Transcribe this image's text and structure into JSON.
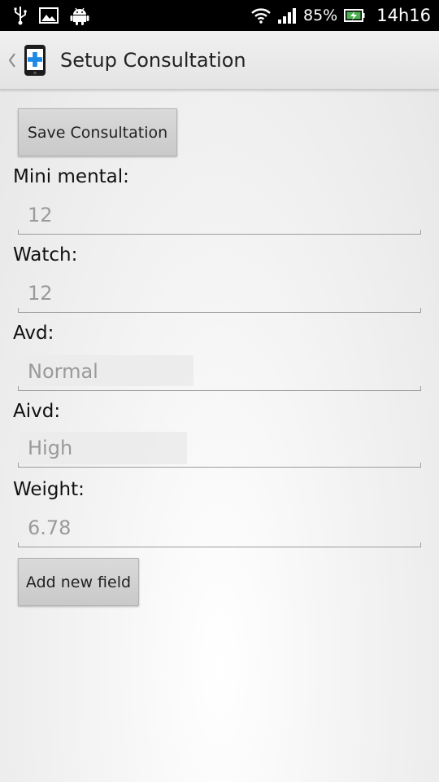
{
  "status_bar": {
    "battery_percent": "85%",
    "time": "14h16",
    "icons": [
      "usb-icon",
      "image-icon",
      "android-icon",
      "wifi-icon",
      "signal-icon",
      "battery-icon"
    ]
  },
  "action_bar": {
    "title": "Setup Consultation",
    "icons": [
      "back-caret-icon",
      "app-medical-phone-icon"
    ]
  },
  "form": {
    "save_button": "Save Consultation",
    "fields": [
      {
        "label": "Mini mental:",
        "value": "12"
      },
      {
        "label": "Watch:",
        "value": "12"
      },
      {
        "label": "Avd:",
        "value": "Normal"
      },
      {
        "label": "Aivd:",
        "value": "High"
      },
      {
        "label": "Weight:",
        "value": "6.78"
      }
    ],
    "add_field_button": "Add new field"
  },
  "colors": {
    "status_bar_bg": "#000000",
    "action_bar_bg": "#e8e8e8",
    "accent_cross": "#1e88e5",
    "input_text": "#9a9a9a"
  }
}
